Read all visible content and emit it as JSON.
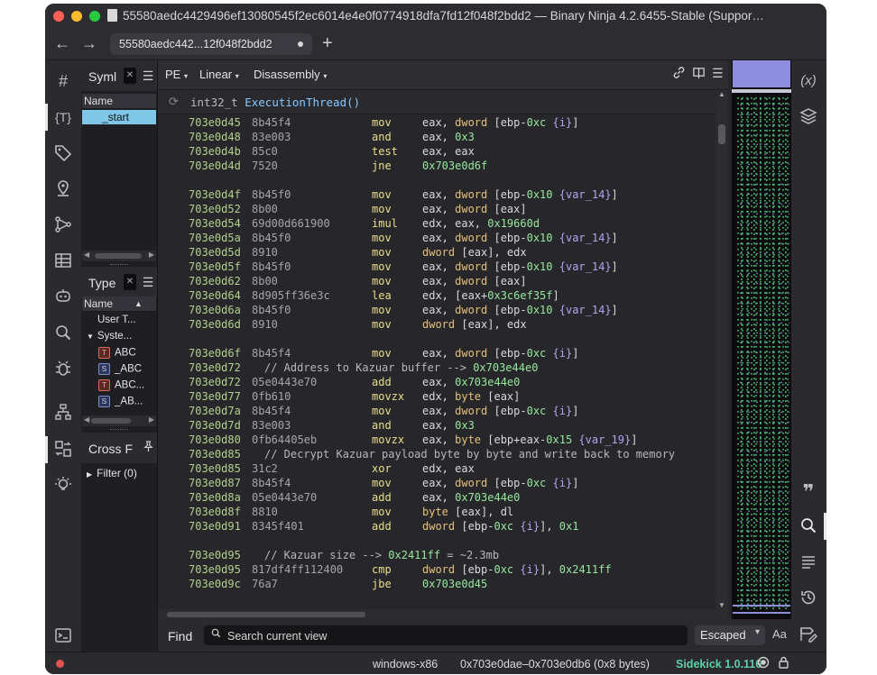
{
  "window": {
    "title": "55580aedc4429496ef13080545f2ec6014e4e0f0774918dfa7fd12f048f2bdd2 — Binary Ninja 4.2.6455-Stable (Suppor…"
  },
  "tabs": [
    {
      "label": "55580aedc442...12f048f2bdd2"
    }
  ],
  "left_sidebar": {
    "icons": [
      "hash-icon",
      "types-icon",
      "tag-icon",
      "location-icon",
      "graph-icon",
      "table-icon",
      "chat-icon",
      "search-icon",
      "bug-icon",
      "hierarchy-icon",
      "cross-reference-icon",
      "bulb-icon",
      "terminal-icon"
    ]
  },
  "symbols_panel": {
    "title": "Syml",
    "column": "Name",
    "items": [
      "_start"
    ]
  },
  "types_panel": {
    "title": "Type",
    "column": "Name",
    "items": [
      {
        "label": "User T...",
        "badge": ""
      },
      {
        "label": "Syste...",
        "badge": "",
        "expanded": true
      },
      {
        "label": "ABC",
        "badge": "T"
      },
      {
        "label": "_ABC",
        "badge": "S"
      },
      {
        "label": "ABC...",
        "badge": "T"
      },
      {
        "label": "_AB...",
        "badge": "S"
      }
    ]
  },
  "xref_panel": {
    "title": "Cross F",
    "filter": "Filter (0)"
  },
  "toolbar": {
    "format": "PE",
    "view_mode": "Linear",
    "view_type": "Disassembly"
  },
  "function_header": {
    "return_type": "int32_t",
    "name": "ExecutionThread()"
  },
  "code": [
    {
      "addr": "703e0d45",
      "bytes": "8b45f4",
      "mn": "mov",
      "ops": [
        [
          "eax, ",
          ""
        ],
        [
          "dword",
          "kw"
        ],
        [
          " [ebp-",
          ""
        ],
        [
          "0xc",
          "num"
        ],
        [
          " ",
          ""
        ],
        [
          "{i}",
          "var"
        ],
        [
          "]",
          ""
        ]
      ]
    },
    {
      "addr": "703e0d48",
      "bytes": "83e003",
      "mn": "and",
      "ops": [
        [
          "eax, ",
          ""
        ],
        [
          "0x3",
          "num"
        ]
      ]
    },
    {
      "addr": "703e0d4b",
      "bytes": "85c0",
      "mn": "test",
      "ops": [
        [
          "eax, eax",
          ""
        ]
      ]
    },
    {
      "addr": "703e0d4d",
      "bytes": "7520",
      "mn": "jne",
      "ops": [
        [
          "0x703e0d6f",
          "num"
        ]
      ]
    },
    {
      "blank": true
    },
    {
      "addr": "703e0d4f",
      "bytes": "8b45f0",
      "mn": "mov",
      "ops": [
        [
          "eax, ",
          ""
        ],
        [
          "dword",
          "kw"
        ],
        [
          " [ebp-",
          ""
        ],
        [
          "0x10",
          "num"
        ],
        [
          " ",
          ""
        ],
        [
          "{var_14}",
          "var"
        ],
        [
          "]",
          ""
        ]
      ]
    },
    {
      "addr": "703e0d52",
      "bytes": "8b00",
      "mn": "mov",
      "ops": [
        [
          "eax, ",
          ""
        ],
        [
          "dword",
          "kw"
        ],
        [
          " [eax]",
          ""
        ]
      ]
    },
    {
      "addr": "703e0d54",
      "bytes": "69d00d661900",
      "mn": "imul",
      "ops": [
        [
          "edx, eax, ",
          ""
        ],
        [
          "0x19660d",
          "num"
        ]
      ]
    },
    {
      "addr": "703e0d5a",
      "bytes": "8b45f0",
      "mn": "mov",
      "ops": [
        [
          "eax, ",
          ""
        ],
        [
          "dword",
          "kw"
        ],
        [
          " [ebp-",
          ""
        ],
        [
          "0x10",
          "num"
        ],
        [
          " ",
          ""
        ],
        [
          "{var_14}",
          "var"
        ],
        [
          "]",
          ""
        ]
      ]
    },
    {
      "addr": "703e0d5d",
      "bytes": "8910",
      "mn": "mov",
      "ops": [
        [
          "dword",
          "kw"
        ],
        [
          " [eax], edx",
          ""
        ]
      ]
    },
    {
      "addr": "703e0d5f",
      "bytes": "8b45f0",
      "mn": "mov",
      "ops": [
        [
          "eax, ",
          ""
        ],
        [
          "dword",
          "kw"
        ],
        [
          " [ebp-",
          ""
        ],
        [
          "0x10",
          "num"
        ],
        [
          " ",
          ""
        ],
        [
          "{var_14}",
          "var"
        ],
        [
          "]",
          ""
        ]
      ]
    },
    {
      "addr": "703e0d62",
      "bytes": "8b00",
      "mn": "mov",
      "ops": [
        [
          "eax, ",
          ""
        ],
        [
          "dword",
          "kw"
        ],
        [
          " [eax]",
          ""
        ]
      ]
    },
    {
      "addr": "703e0d64",
      "bytes": "8d905ff36e3c",
      "mn": "lea",
      "ops": [
        [
          "edx, [eax+",
          ""
        ],
        [
          "0x3c6ef35f",
          "num"
        ],
        [
          "]",
          ""
        ]
      ]
    },
    {
      "addr": "703e0d6a",
      "bytes": "8b45f0",
      "mn": "mov",
      "ops": [
        [
          "eax, ",
          ""
        ],
        [
          "dword",
          "kw"
        ],
        [
          " [ebp-",
          ""
        ],
        [
          "0x10",
          "num"
        ],
        [
          " ",
          ""
        ],
        [
          "{var_14}",
          "var"
        ],
        [
          "]",
          ""
        ]
      ]
    },
    {
      "addr": "703e0d6d",
      "bytes": "8910",
      "mn": "mov",
      "ops": [
        [
          "dword",
          "kw"
        ],
        [
          " [eax], edx",
          ""
        ]
      ]
    },
    {
      "blank": true
    },
    {
      "addr": "703e0d6f",
      "bytes": "8b45f4",
      "mn": "mov",
      "ops": [
        [
          "eax, ",
          ""
        ],
        [
          "dword",
          "kw"
        ],
        [
          " [ebp-",
          ""
        ],
        [
          "0xc",
          "num"
        ],
        [
          " ",
          ""
        ],
        [
          "{i}",
          "var"
        ],
        [
          "]",
          ""
        ]
      ]
    },
    {
      "addr": "703e0d72",
      "comment": [
        [
          "// Address to Kazuar buffer --> ",
          ""
        ],
        [
          "0x703e44e0",
          "num"
        ]
      ]
    },
    {
      "addr": "703e0d72",
      "bytes": "05e0443e70",
      "mn": "add",
      "ops": [
        [
          "eax, ",
          ""
        ],
        [
          "0x703e44e0",
          "num"
        ]
      ]
    },
    {
      "addr": "703e0d77",
      "bytes": "0fb610",
      "mn": "movzx",
      "ops": [
        [
          "edx, ",
          ""
        ],
        [
          "byte",
          "kw"
        ],
        [
          " [eax]",
          ""
        ]
      ]
    },
    {
      "addr": "703e0d7a",
      "bytes": "8b45f4",
      "mn": "mov",
      "ops": [
        [
          "eax, ",
          ""
        ],
        [
          "dword",
          "kw"
        ],
        [
          " [ebp-",
          ""
        ],
        [
          "0xc",
          "num"
        ],
        [
          " ",
          ""
        ],
        [
          "{i}",
          "var"
        ],
        [
          "]",
          ""
        ]
      ]
    },
    {
      "addr": "703e0d7d",
      "bytes": "83e003",
      "mn": "and",
      "ops": [
        [
          "eax, ",
          ""
        ],
        [
          "0x3",
          "num"
        ]
      ]
    },
    {
      "addr": "703e0d80",
      "bytes": "0fb64405eb",
      "mn": "movzx",
      "ops": [
        [
          "eax, ",
          ""
        ],
        [
          "byte",
          "kw"
        ],
        [
          " [ebp+eax-",
          ""
        ],
        [
          "0x15",
          "num"
        ],
        [
          " ",
          ""
        ],
        [
          "{var_19}",
          "var"
        ],
        [
          "]",
          ""
        ]
      ]
    },
    {
      "addr": "703e0d85",
      "comment": [
        [
          "// Decrypt Kazuar payload byte by byte and write back to memory",
          ""
        ]
      ]
    },
    {
      "addr": "703e0d85",
      "bytes": "31c2",
      "mn": "xor",
      "ops": [
        [
          "edx, eax",
          ""
        ]
      ]
    },
    {
      "addr": "703e0d87",
      "bytes": "8b45f4",
      "mn": "mov",
      "ops": [
        [
          "eax, ",
          ""
        ],
        [
          "dword",
          "kw"
        ],
        [
          " [ebp-",
          ""
        ],
        [
          "0xc",
          "num"
        ],
        [
          " ",
          ""
        ],
        [
          "{i}",
          "var"
        ],
        [
          "]",
          ""
        ]
      ]
    },
    {
      "addr": "703e0d8a",
      "bytes": "05e0443e70",
      "mn": "add",
      "ops": [
        [
          "eax, ",
          ""
        ],
        [
          "0x703e44e0",
          "num"
        ]
      ]
    },
    {
      "addr": "703e0d8f",
      "bytes": "8810",
      "mn": "mov",
      "ops": [
        [
          "byte",
          "kw"
        ],
        [
          " [eax], dl",
          ""
        ]
      ]
    },
    {
      "addr": "703e0d91",
      "bytes": "8345f401",
      "mn": "add",
      "ops": [
        [
          "dword",
          "kw"
        ],
        [
          " [ebp-",
          ""
        ],
        [
          "0xc",
          "num"
        ],
        [
          " ",
          ""
        ],
        [
          "{i}",
          "var"
        ],
        [
          "], ",
          ""
        ],
        [
          "0x1",
          "num"
        ]
      ]
    },
    {
      "blank": true
    },
    {
      "addr": "703e0d95",
      "comment": [
        [
          "// Kazuar size --> ",
          ""
        ],
        [
          "0x2411ff",
          "num"
        ],
        [
          " = ~2.3mb",
          ""
        ]
      ]
    },
    {
      "addr": "703e0d95",
      "bytes": "817df4ff112400",
      "mn": "cmp",
      "ops": [
        [
          "dword",
          "kw"
        ],
        [
          " [ebp-",
          ""
        ],
        [
          "0xc",
          "num"
        ],
        [
          " ",
          ""
        ],
        [
          "{i}",
          "var"
        ],
        [
          "], ",
          ""
        ],
        [
          "0x2411ff",
          "num"
        ]
      ]
    },
    {
      "addr": "703e0d9c",
      "bytes": "76a7",
      "mn": "jbe",
      "ops": [
        [
          "0x703e0d45",
          "num"
        ]
      ]
    }
  ],
  "find_bar": {
    "label": "Find",
    "placeholder": "Search current view",
    "mode": "Escaped",
    "case_toggle": "Aa"
  },
  "status_bar": {
    "platform": "windows-x86",
    "selection": "0x703e0dae–0x703e0db6 (0x8 bytes)",
    "sidekick": "Sidekick 1.0.116"
  },
  "right_sidebar": {
    "icons": [
      "variable-icon",
      "layers-icon",
      "quote-icon",
      "search-icon",
      "list-icon",
      "history-icon",
      "tag-edit-icon"
    ]
  }
}
